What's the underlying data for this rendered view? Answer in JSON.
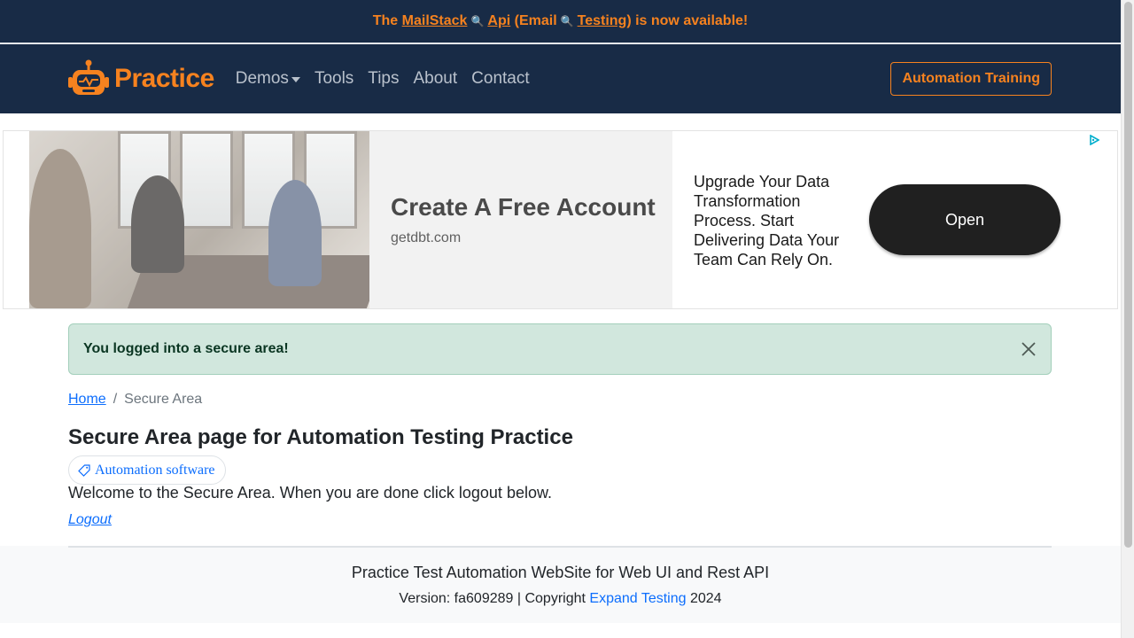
{
  "announcement": {
    "prefix": "The",
    "mailstack": "MailStack",
    "api": "Api",
    "email_open": "(Email",
    "testing": "Testing)",
    "suffix": "is now available!"
  },
  "navbar": {
    "brand": "Practice",
    "links": [
      "Demos",
      "Tools",
      "Tips",
      "About",
      "Contact"
    ],
    "cta": "Automation Training"
  },
  "ad": {
    "headline": "Create A Free Account",
    "domain": "getdbt.com",
    "description": "Upgrade Your Data Transformation Process. Start Delivering Data Your Team Can Rely On.",
    "button": "Open"
  },
  "alert": {
    "message": "You logged into a secure area!"
  },
  "breadcrumb": {
    "home": "Home",
    "separator": "/",
    "current": "Secure Area"
  },
  "main": {
    "title": "Secure Area page for Automation Testing Practice",
    "tag": "Automation software",
    "welcome": "Welcome to the Secure Area. When you are done click logout below.",
    "logout": "Logout"
  },
  "footer": {
    "title": "Practice Test Automation WebSite for Web UI and Rest API",
    "version_text": "Version: fa609289 | Copyright",
    "company": "Expand Testing",
    "year": "2024"
  },
  "colors": {
    "navy": "#182b46",
    "orange": "#f6821f",
    "link": "#0d6efd",
    "success_bg": "#d1e7dd"
  },
  "icons": [
    "robot-logo-icon",
    "magnifier-icon",
    "chevron-down-icon",
    "tag-icon",
    "close-icon",
    "adchoices-icon"
  ]
}
